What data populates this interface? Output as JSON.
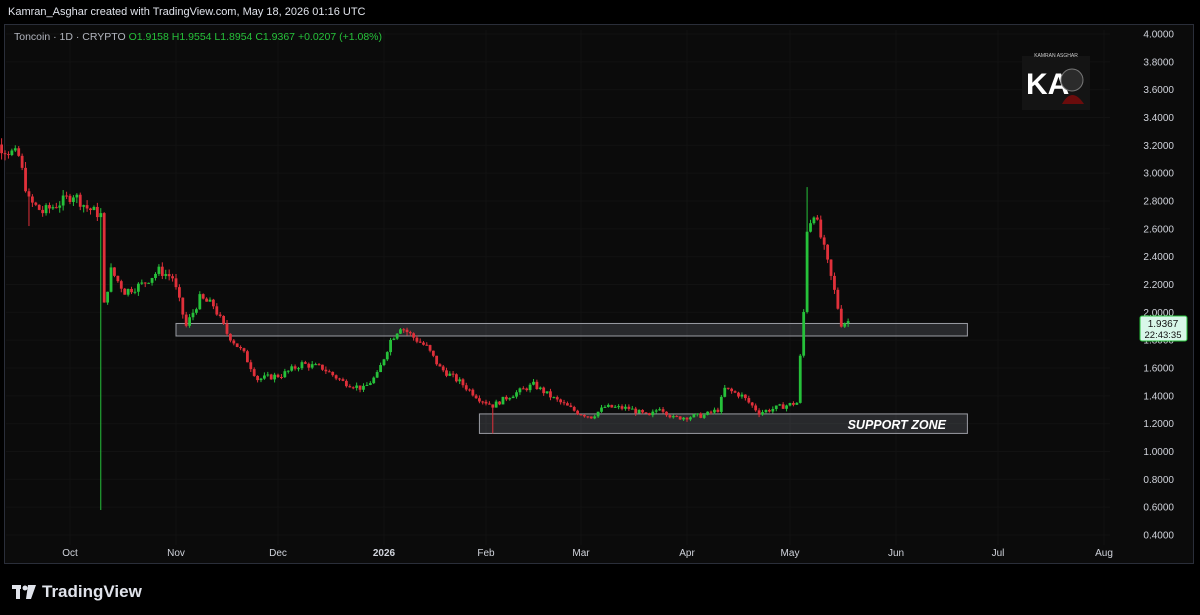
{
  "header": {
    "attribution": "Kamran_Asghar created with TradingView.com, May 18, 2026 01:16 UTC"
  },
  "symbol": {
    "name": "Toncoin · 1D · CRYPTO",
    "open": "O1.9158",
    "high": "H1.9554",
    "low": "L1.8954",
    "close": "C1.9367",
    "change": "+0.0207 (+1.08%)"
  },
  "price_label": {
    "value": "1.9367",
    "countdown": "22:43:35"
  },
  "annotation": {
    "support_label": "SUPPORT ZONE"
  },
  "watermark": {
    "text": "KAMRAN  ASGHAR"
  },
  "footer": {
    "logo_text": "TradingView"
  },
  "colors": {
    "up": "#26c13a",
    "down": "#e0303a",
    "background": "#0b0b0b",
    "price_badge": "#d8f7e9"
  },
  "chart_data": {
    "type": "candlestick",
    "series_name": "Toncoin 1D",
    "x_ticks": [
      "Oct",
      "Nov",
      "Dec",
      "2026",
      "Feb",
      "Mar",
      "Apr",
      "May",
      "Jun",
      "Jul",
      "Aug"
    ],
    "y_ticks": [
      "0.4000",
      "0.6000",
      "0.8000",
      "1.0000",
      "1.2000",
      "1.4000",
      "1.6000",
      "1.8000",
      "2.0000",
      "2.2000",
      "2.4000",
      "2.6000",
      "2.8000",
      "3.0000",
      "3.2000",
      "3.4000",
      "3.6000",
      "3.8000",
      "4.0000"
    ],
    "ylim": [
      0.4,
      4.0
    ],
    "zones": [
      {
        "name": "resistance-flip",
        "from": "2025-11-01",
        "to": "2026-06-22",
        "low": 1.83,
        "high": 1.92
      },
      {
        "name": "support-zone",
        "from": "2026-01-30",
        "to": "2026-06-22",
        "low": 1.13,
        "high": 1.27
      }
    ],
    "path": [
      [
        "2025-09-04",
        3.25
      ],
      [
        "2025-09-10",
        3.2
      ],
      [
        "2025-09-16",
        3.12
      ],
      [
        "2025-09-19",
        2.8
      ],
      [
        "2025-09-23",
        2.72
      ],
      [
        "2025-09-29",
        2.8
      ],
      [
        "2025-10-02",
        2.85
      ],
      [
        "2025-10-06",
        2.75
      ],
      [
        "2025-10-10",
        2.7
      ],
      [
        "2025-10-11",
        2.05
      ],
      [
        "2025-10-13",
        2.3
      ],
      [
        "2025-10-17",
        2.15
      ],
      [
        "2025-10-22",
        2.2
      ],
      [
        "2025-10-27",
        2.3
      ],
      [
        "2025-10-31",
        2.25
      ],
      [
        "2025-11-04",
        1.9
      ],
      [
        "2025-11-08",
        2.1
      ],
      [
        "2025-11-12",
        2.05
      ],
      [
        "2025-11-16",
        1.85
      ],
      [
        "2025-11-21",
        1.7
      ],
      [
        "2025-11-25",
        1.52
      ],
      [
        "2025-12-02",
        1.55
      ],
      [
        "2025-12-08",
        1.63
      ],
      [
        "2025-12-14",
        1.6
      ],
      [
        "2025-12-20",
        1.5
      ],
      [
        "2025-12-26",
        1.45
      ],
      [
        "2025-12-30",
        1.55
      ],
      [
        "2026-01-03",
        1.8
      ],
      [
        "2026-01-06",
        1.9
      ],
      [
        "2026-01-10",
        1.82
      ],
      [
        "2026-01-14",
        1.75
      ],
      [
        "2026-01-18",
        1.6
      ],
      [
        "2026-01-24",
        1.5
      ],
      [
        "2026-01-30",
        1.38
      ],
      [
        "2026-02-03",
        1.33
      ],
      [
        "2026-02-08",
        1.4
      ],
      [
        "2026-02-15",
        1.48
      ],
      [
        "2026-02-21",
        1.38
      ],
      [
        "2026-02-28",
        1.28
      ],
      [
        "2026-03-04",
        1.25
      ],
      [
        "2026-03-08",
        1.32
      ],
      [
        "2026-03-15",
        1.31
      ],
      [
        "2026-03-21",
        1.25
      ],
      [
        "2026-03-24",
        1.32
      ],
      [
        "2026-03-28",
        1.24
      ],
      [
        "2026-04-06",
        1.26
      ],
      [
        "2026-04-10",
        1.3
      ],
      [
        "2026-04-12",
        1.45
      ],
      [
        "2026-04-17",
        1.4
      ],
      [
        "2026-04-22",
        1.28
      ],
      [
        "2026-04-28",
        1.32
      ],
      [
        "2026-05-03",
        1.35
      ],
      [
        "2026-05-05",
        2.0
      ],
      [
        "2026-05-06",
        2.6
      ],
      [
        "2026-05-08",
        2.72
      ],
      [
        "2026-05-11",
        2.45
      ],
      [
        "2026-05-14",
        2.15
      ],
      [
        "2026-05-16",
        1.92
      ],
      [
        "2026-05-18",
        1.94
      ]
    ]
  }
}
